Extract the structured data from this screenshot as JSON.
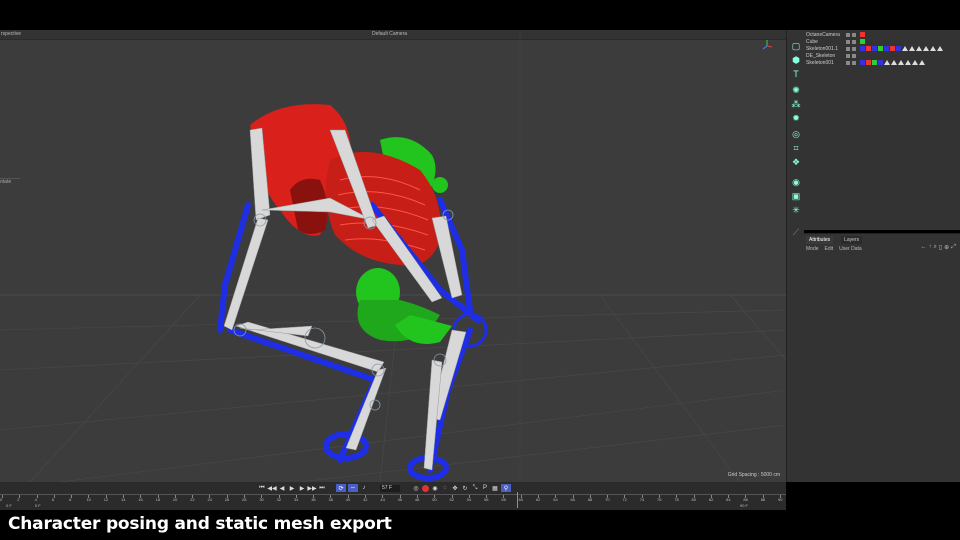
{
  "viewport": {
    "view_label": "rspective",
    "camera_label": "Default Camera",
    "side_tag": "otate",
    "grid_spacing": "Grid Spacing : 5000 cm"
  },
  "objects": [
    {
      "name": "OctaneCamera"
    },
    {
      "name": "Cube"
    },
    {
      "name": "Skeleton001.1"
    },
    {
      "name": "DE_Skeleton"
    },
    {
      "name": "Skeleton001"
    }
  ],
  "attributes": {
    "tabs": [
      "Attributes",
      "Layers"
    ],
    "menu": [
      "Mode",
      "Edit",
      "User Data"
    ]
  },
  "timeline": {
    "frame_value": "57 F",
    "range_start": "0 F",
    "range_start2": "0 F",
    "range_end": "90 F",
    "ticks": [
      "0",
      "2",
      "4",
      "6",
      "8",
      "10",
      "12",
      "14",
      "16",
      "18",
      "20",
      "22",
      "24",
      "26",
      "28",
      "30",
      "32",
      "34",
      "36",
      "38",
      "40",
      "42",
      "44",
      "46",
      "48",
      "50",
      "52",
      "54",
      "56",
      "58",
      "60",
      "62",
      "64",
      "66",
      "68",
      "70",
      "72",
      "74",
      "76",
      "78",
      "80",
      "82",
      "84",
      "86",
      "88",
      "90"
    ]
  },
  "caption": "Character posing and static mesh export",
  "colors": {
    "skeleton_red": "#d9201a",
    "skeleton_green": "#22c41e",
    "bones_blue": "#1e2ee6",
    "bones_white": "#d8d8d8",
    "accent": "#4a5fc4"
  }
}
